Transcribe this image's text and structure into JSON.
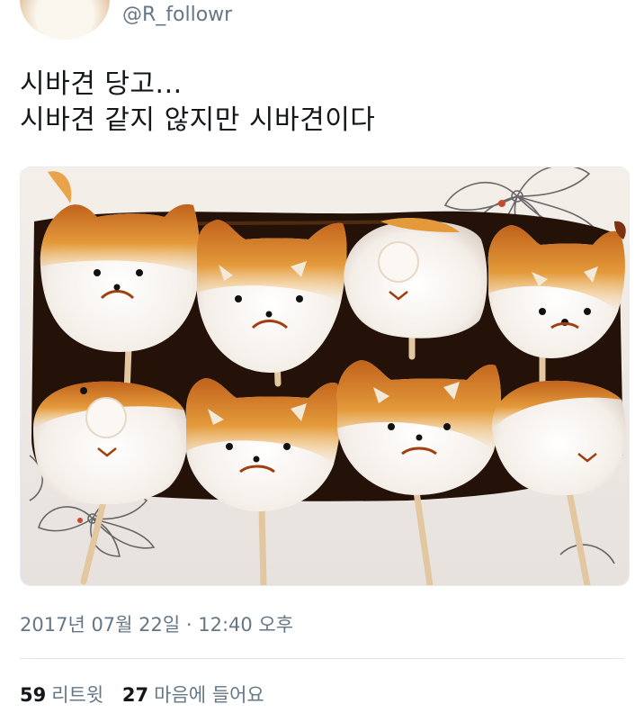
{
  "author": {
    "handle": "@R_followr"
  },
  "tweet": {
    "lines": [
      "시바견 당고...",
      "시바견 같지 않지만 시바견이다"
    ]
  },
  "timestamp": "2017년 07월 22일 · 12:40 오후",
  "stats": {
    "retweets_count": "59",
    "retweets_label": "리트윗",
    "likes_count": "27",
    "likes_label": "마음에 들어요"
  },
  "colors": {
    "text": "#14171a",
    "muted": "#657786",
    "divider": "#e1e8ed"
  }
}
